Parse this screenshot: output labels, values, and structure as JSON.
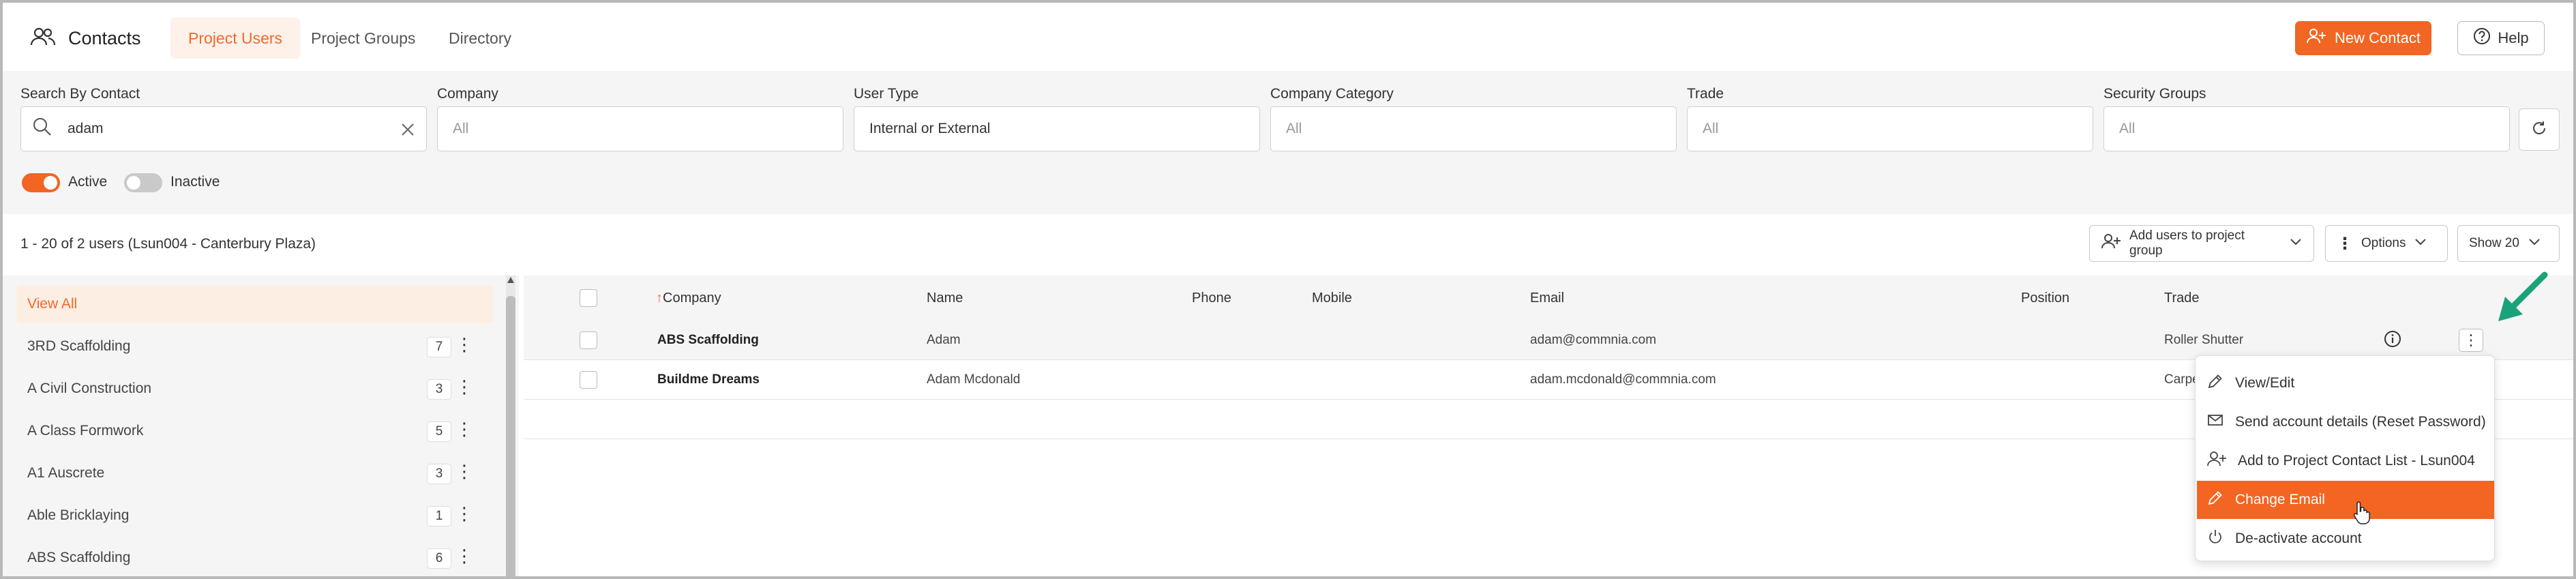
{
  "header": {
    "app_title": "Contacts",
    "tabs": [
      {
        "label": "Project Users",
        "active": true
      },
      {
        "label": "Project Groups",
        "active": false
      },
      {
        "label": "Directory",
        "active": false
      }
    ],
    "new_contact_label": "New Contact",
    "help_label": "Help"
  },
  "filters": {
    "search_label": "Search By Contact",
    "search_value": "adam",
    "company_label": "Company",
    "company_placeholder": "All",
    "user_type_label": "User Type",
    "user_type_value": "Internal or External",
    "company_category_label": "Company Category",
    "company_category_placeholder": "All",
    "trade_label": "Trade",
    "trade_placeholder": "All",
    "security_groups_label": "Security Groups",
    "security_groups_placeholder": "All",
    "active_label": "Active",
    "active_on": true,
    "inactive_label": "Inactive",
    "inactive_on": false
  },
  "results": {
    "count_text": "1 - 20 of 2 users (Lsun004 - Canterbury Plaza)",
    "add_to_group_label": "Add users to project group",
    "options_label": "Options",
    "show_label": "Show 20"
  },
  "sidebar": {
    "items": [
      {
        "label": "View All",
        "count": "",
        "active": true
      },
      {
        "label": "3RD Scaffolding",
        "count": "7"
      },
      {
        "label": "A Civil Construction",
        "count": "3"
      },
      {
        "label": "A Class Formwork",
        "count": "5"
      },
      {
        "label": "A1 Auscrete",
        "count": "3"
      },
      {
        "label": "Able Bricklaying",
        "count": "1"
      },
      {
        "label": "ABS Scaffolding",
        "count": "6"
      }
    ]
  },
  "table": {
    "columns": [
      "Company",
      "Name",
      "Phone",
      "Mobile",
      "Email",
      "Position",
      "Trade"
    ],
    "sort_indicator": "↑",
    "rows": [
      {
        "company": "ABS Scaffolding",
        "name": "Adam",
        "phone": "",
        "mobile": "",
        "email": "adam@commnia.com",
        "position": "",
        "trade": "Roller Shutter"
      },
      {
        "company": "Buildme Dreams",
        "name": "Adam Mcdonald",
        "phone": "",
        "mobile": "",
        "email": "adam.mcdonald@commnia.com",
        "position": "",
        "trade": "Carpe"
      }
    ]
  },
  "row_menu": {
    "items": [
      {
        "label": "View/Edit",
        "icon": "pencil-icon"
      },
      {
        "label": "Send account details (Reset Password)",
        "icon": "envelope-icon"
      },
      {
        "label": "Add to Project Contact List - Lsun004",
        "icon": "add-user-icon"
      },
      {
        "label": "Change Email",
        "icon": "pencil-icon",
        "highlighted": true
      },
      {
        "label": "De-activate account",
        "icon": "power-icon"
      }
    ]
  },
  "colors": {
    "accent": "#f26522",
    "annotation_arrow": "#1aa37a"
  }
}
